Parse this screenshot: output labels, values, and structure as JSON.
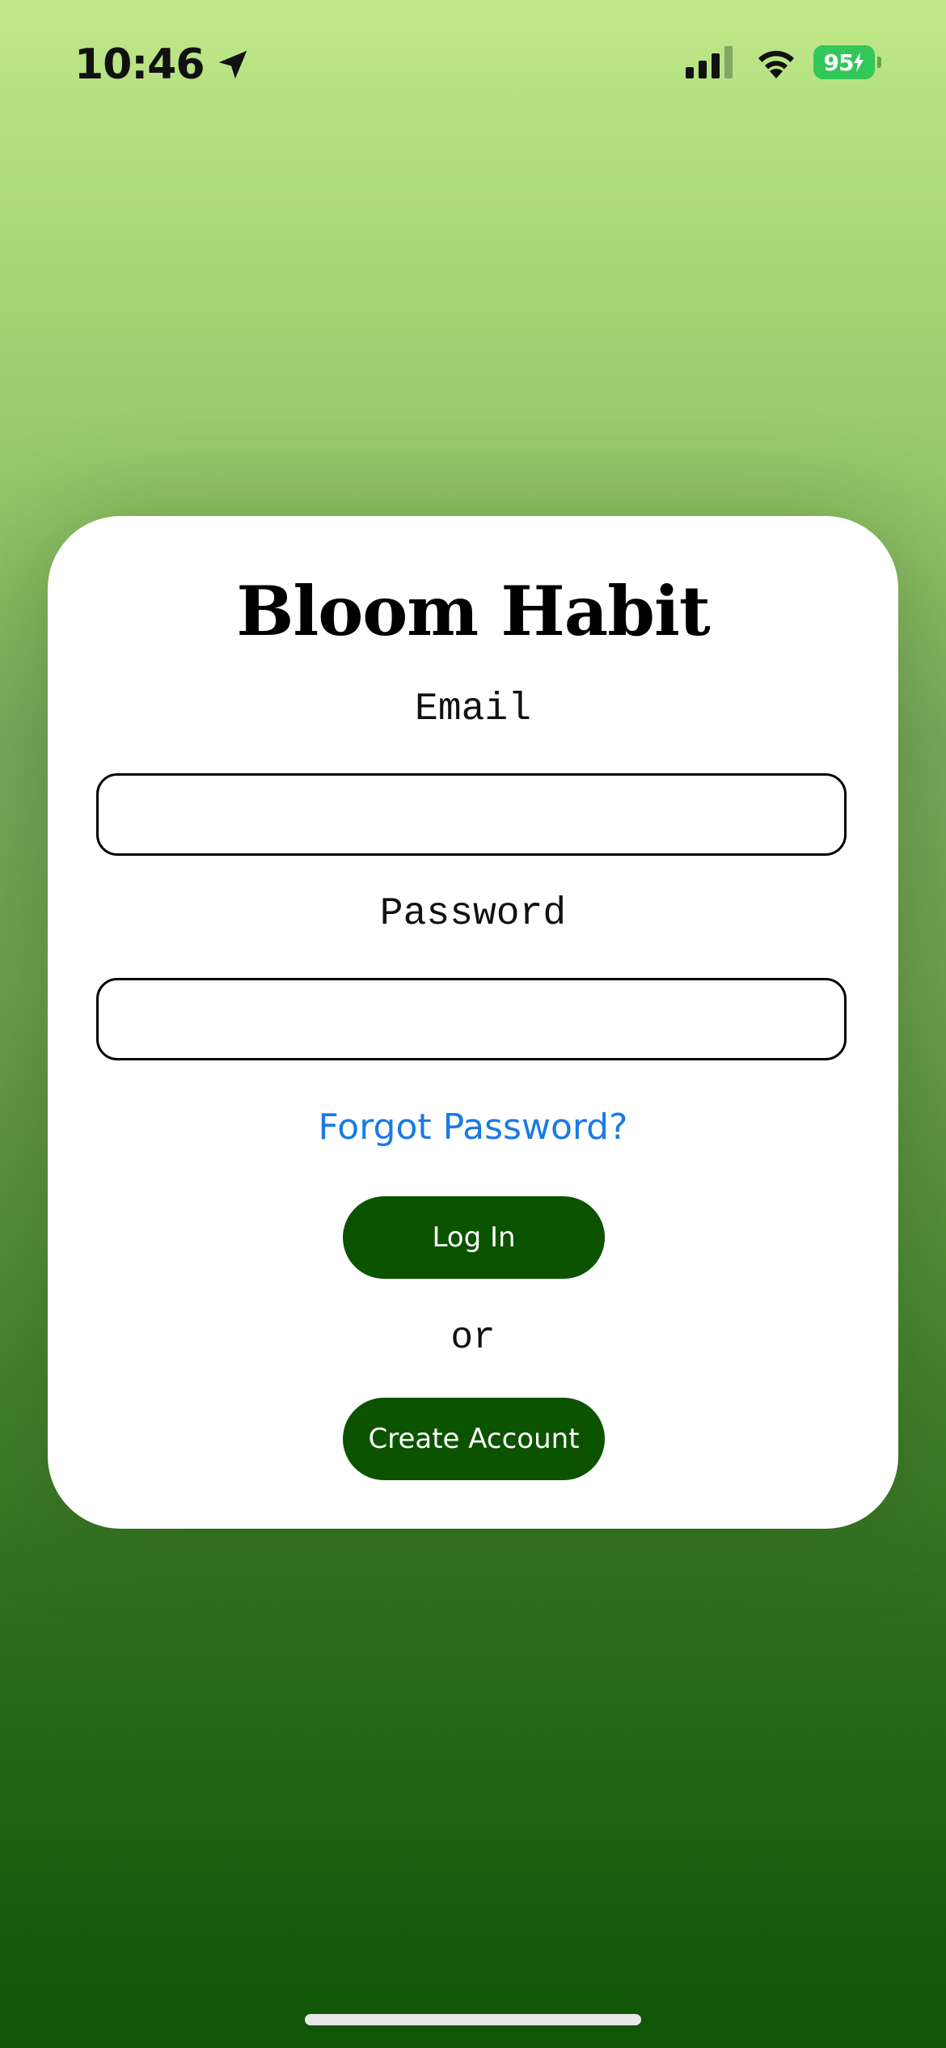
{
  "status_bar": {
    "time": "10:46",
    "battery": "95",
    "icons": [
      "location-arrow-icon",
      "cellular-signal-icon",
      "wifi-icon",
      "battery-charging-icon"
    ],
    "battery_color": "#33c759"
  },
  "login_card": {
    "title": "Bloom Habit",
    "email_label": "Email",
    "email_value": "",
    "password_label": "Password",
    "password_value": "",
    "forgot_password": "Forgot Password?",
    "login_button": "Log In",
    "or_text": "or",
    "create_account_button": "Create Account"
  },
  "colors": {
    "accent_button": "#0c5300",
    "link": "#1a7ae6",
    "background_top": "#bfe889",
    "background_bottom": "#0f5506"
  }
}
